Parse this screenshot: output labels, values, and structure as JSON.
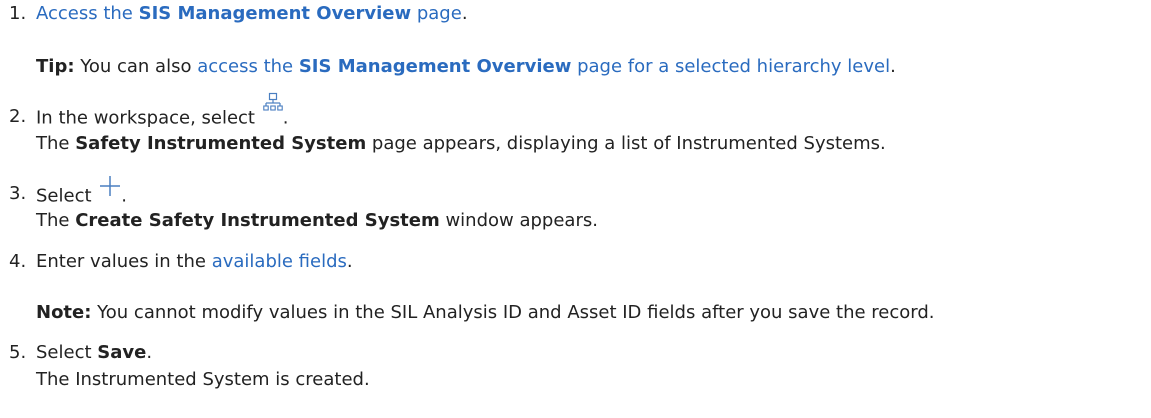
{
  "steps": [
    {
      "number": "1.",
      "link_prefix": "Access the ",
      "link_bold": "SIS Management Overview",
      "link_suffix": " page",
      "after": ".",
      "tip": {
        "label": "Tip:",
        "text_before": " You can also ",
        "link_prefix": "access the ",
        "link_bold": "SIS Management Overview",
        "link_suffix": " page for a selected hierarchy level",
        "after": "."
      }
    },
    {
      "number": "2.",
      "text_before": "In the workspace, select ",
      "icon": "hierarchy-icon",
      "after": ".",
      "result_before": "The ",
      "result_bold": "Safety Instrumented System",
      "result_after": " page appears, displaying a list of Instrumented Systems."
    },
    {
      "number": "3.",
      "text_before": "Select ",
      "icon": "plus-icon",
      "after": ".",
      "result_before": "The ",
      "result_bold": "Create Safety Instrumented System",
      "result_after": " window appears."
    },
    {
      "number": "4.",
      "text_before": "Enter values in the ",
      "link": "available fields",
      "after": ".",
      "note": {
        "label": "Note:",
        "text": " You cannot modify values in the SIL Analysis ID and Asset ID fields after you save the record."
      }
    },
    {
      "number": "5.",
      "text_before": "Select ",
      "bold": "Save",
      "after": ".",
      "result": "The Instrumented System is created."
    }
  ],
  "colors": {
    "link": "#2a6bbf",
    "text": "#222222",
    "icon": "#4a7fc1"
  }
}
